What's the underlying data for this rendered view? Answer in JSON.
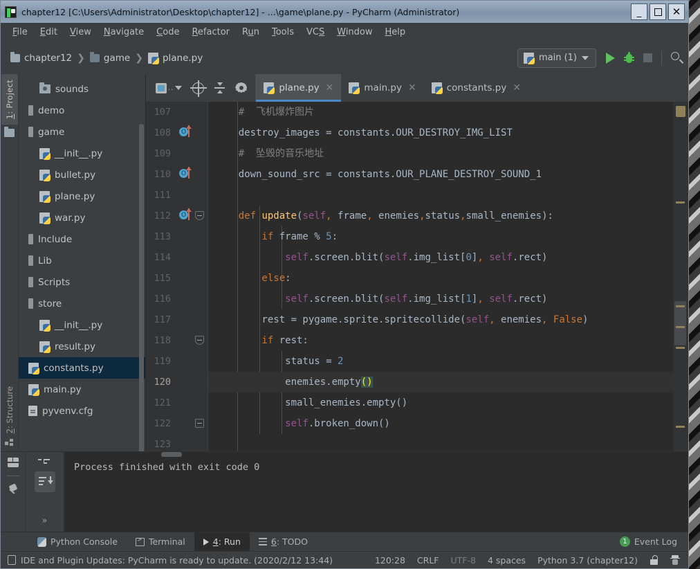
{
  "window": {
    "title": "chapter12 [C:\\Users\\Administrator\\Desktop\\chapter12] - ...\\game\\plane.py - PyCharm (Administrator)",
    "minimize_label": "_",
    "maximize_label": "□",
    "close_label": "✕"
  },
  "menubar": {
    "items": [
      {
        "label": "File",
        "mnemonic": "F"
      },
      {
        "label": "Edit",
        "mnemonic": "E"
      },
      {
        "label": "View",
        "mnemonic": "V"
      },
      {
        "label": "Navigate",
        "mnemonic": "N"
      },
      {
        "label": "Code",
        "mnemonic": "C"
      },
      {
        "label": "Refactor",
        "mnemonic": "R"
      },
      {
        "label": "Run",
        "mnemonic": "u"
      },
      {
        "label": "Tools",
        "mnemonic": "T"
      },
      {
        "label": "VCS",
        "mnemonic": "S"
      },
      {
        "label": "Window",
        "mnemonic": "W"
      },
      {
        "label": "Help",
        "mnemonic": "H"
      }
    ]
  },
  "navbar": {
    "breadcrumbs": [
      {
        "label": "chapter12",
        "icon": "folder-icon"
      },
      {
        "label": "game",
        "icon": "folder-icon"
      },
      {
        "label": "plane.py",
        "icon": "python-file-icon"
      }
    ],
    "separator": "❯",
    "run_config": {
      "label": "main (1)",
      "icon": "python-file-icon",
      "caret": "▾"
    },
    "actions": [
      {
        "name": "run-button",
        "icon": "play-icon"
      },
      {
        "name": "debug-button",
        "icon": "bug-icon"
      },
      {
        "name": "stop-button",
        "icon": "stop-icon"
      },
      {
        "name": "search-button",
        "icon": "search-icon"
      }
    ]
  },
  "left_strip": {
    "project_tab": "1: Project",
    "project_mnemonic": "1",
    "structure_tab": "2: Structure",
    "structure_mnemonic": "2"
  },
  "project_tree": {
    "toolbar_icons": [
      "view-mode-icon",
      "locate-icon",
      "collapse-all-icon",
      "settings-icon"
    ],
    "items": [
      {
        "label": "sounds",
        "indent": 1,
        "icon": "folder-icon",
        "selected": false
      },
      {
        "label": "demo",
        "indent": 0,
        "icon": "dir-bar-icon",
        "selected": false
      },
      {
        "label": "game",
        "indent": 0,
        "icon": "dir-bar-icon",
        "selected": false
      },
      {
        "label": "__init__.py",
        "indent": 1,
        "icon": "python-file-icon",
        "selected": false
      },
      {
        "label": "bullet.py",
        "indent": 1,
        "icon": "python-file-icon",
        "selected": false
      },
      {
        "label": "plane.py",
        "indent": 1,
        "icon": "python-file-icon",
        "selected": false
      },
      {
        "label": "war.py",
        "indent": 1,
        "icon": "python-file-icon",
        "selected": false
      },
      {
        "label": "Include",
        "indent": 0,
        "icon": "dir-bar-icon",
        "selected": false
      },
      {
        "label": "Lib",
        "indent": 0,
        "icon": "dir-bar-icon",
        "selected": false
      },
      {
        "label": "Scripts",
        "indent": 0,
        "icon": "dir-bar-icon",
        "selected": false
      },
      {
        "label": "store",
        "indent": 0,
        "icon": "dir-bar-icon",
        "selected": false
      },
      {
        "label": "__init__.py",
        "indent": 1,
        "icon": "python-file-icon",
        "selected": false
      },
      {
        "label": "result.py",
        "indent": 1,
        "icon": "python-file-icon",
        "selected": false
      },
      {
        "label": "constants.py",
        "indent": 0,
        "icon": "python-file-icon",
        "selected": true
      },
      {
        "label": "main.py",
        "indent": 0,
        "icon": "python-file-icon",
        "selected": false
      },
      {
        "label": "pyvenv.cfg",
        "indent": 0,
        "icon": "config-file-icon",
        "selected": false
      }
    ]
  },
  "editor_tabs": [
    {
      "label": "plane.py",
      "active": true,
      "close": "✕"
    },
    {
      "label": "main.py",
      "active": false,
      "close": "✕"
    },
    {
      "label": "constants.py",
      "active": false,
      "close": "✕"
    }
  ],
  "editor": {
    "first_line": 107,
    "current_line": 120,
    "lines": [
      {
        "num": 107,
        "gutter": [],
        "fold": null,
        "indent_guides": 1
      },
      {
        "num": 108,
        "gutter": [
          "override-icon"
        ],
        "fold": null,
        "indent_guides": 1
      },
      {
        "num": 109,
        "gutter": [],
        "fold": null,
        "indent_guides": 1
      },
      {
        "num": 110,
        "gutter": [
          "override-icon"
        ],
        "fold": null,
        "indent_guides": 1
      },
      {
        "num": 111,
        "gutter": [],
        "fold": null,
        "indent_guides": 1
      },
      {
        "num": 112,
        "gutter": [
          "override-icon"
        ],
        "fold": "open",
        "indent_guides": 1
      },
      {
        "num": 113,
        "gutter": [],
        "fold": null,
        "indent_guides": 2
      },
      {
        "num": 114,
        "gutter": [],
        "fold": null,
        "indent_guides": 3
      },
      {
        "num": 115,
        "gutter": [],
        "fold": null,
        "indent_guides": 2
      },
      {
        "num": 116,
        "gutter": [],
        "fold": null,
        "indent_guides": 3
      },
      {
        "num": 117,
        "gutter": [],
        "fold": null,
        "indent_guides": 2
      },
      {
        "num": 118,
        "gutter": [],
        "fold": "open",
        "indent_guides": 2
      },
      {
        "num": 119,
        "gutter": [],
        "fold": null,
        "indent_guides": 3
      },
      {
        "num": 120,
        "gutter": [],
        "fold": null,
        "indent_guides": 3
      },
      {
        "num": 121,
        "gutter": [],
        "fold": null,
        "indent_guides": 3
      },
      {
        "num": 122,
        "gutter": [],
        "fold": "end",
        "indent_guides": 3
      },
      {
        "num": 123,
        "gutter": [],
        "fold": null,
        "indent_guides": 1
      }
    ],
    "code_text": [
      "    # 飞机爆炸图片",
      "    destroy_images = constants.OUR_DESTROY_IMG_LIST",
      "    # 坠毁的音乐地址",
      "    down_sound_src = constants.OUR_PLANE_DESTROY_SOUND_1",
      "",
      "    def update(self, frame, enemies,status,small_enemies):",
      "        if frame % 5:",
      "            self.screen.blit(self.img_list[0], self.rect)",
      "        else:",
      "            self.screen.blit(self.img_list[1], self.rect)",
      "        rest = pygame.sprite.spritecollide(self, enemies, False)",
      "        if rest:",
      "            status = 2",
      "            enemies.empty()",
      "            small_enemies.empty()",
      "            self.broken_down()",
      ""
    ],
    "override_icon_glyph": "O"
  },
  "run_panel": {
    "side_icons": [
      "layout-icon",
      "pin-icon"
    ],
    "action_icons": [
      "soft-wrap-icon",
      "scroll-to-end-icon"
    ],
    "more_glyph": "»",
    "console_output": "Process finished with exit code 0"
  },
  "toolwindow_tabs": [
    {
      "label": "Python Console",
      "icon": "python-console-icon",
      "active": false,
      "mnemonic": ""
    },
    {
      "label": "Terminal",
      "icon": "terminal-icon",
      "active": false,
      "mnemonic": ""
    },
    {
      "label": "4: Run",
      "icon": "run-icon",
      "active": true,
      "mnemonic": "4"
    },
    {
      "label": "6: TODO",
      "icon": "todo-icon",
      "active": false,
      "mnemonic": "6"
    }
  ],
  "event_log": {
    "count": "1",
    "label": "Event Log"
  },
  "statusbar": {
    "message": "IDE and Plugin Updates: PyCharm is ready to update. (2020/2/12 13:44)",
    "caret_position": "120:28",
    "line_separator": "CRLF",
    "encoding": "UTF-8",
    "indent": "4 spaces",
    "interpreter": "Python 3.7 (chapter12)",
    "icons": [
      "lock-icon",
      "inspector-icon"
    ]
  },
  "colors": {
    "accent_tab": "#4a88c7",
    "selection": "#0d293e",
    "editor_bg": "#2b2b2b",
    "panel_bg": "#3c3f41",
    "run_green": "#5ec15e"
  }
}
